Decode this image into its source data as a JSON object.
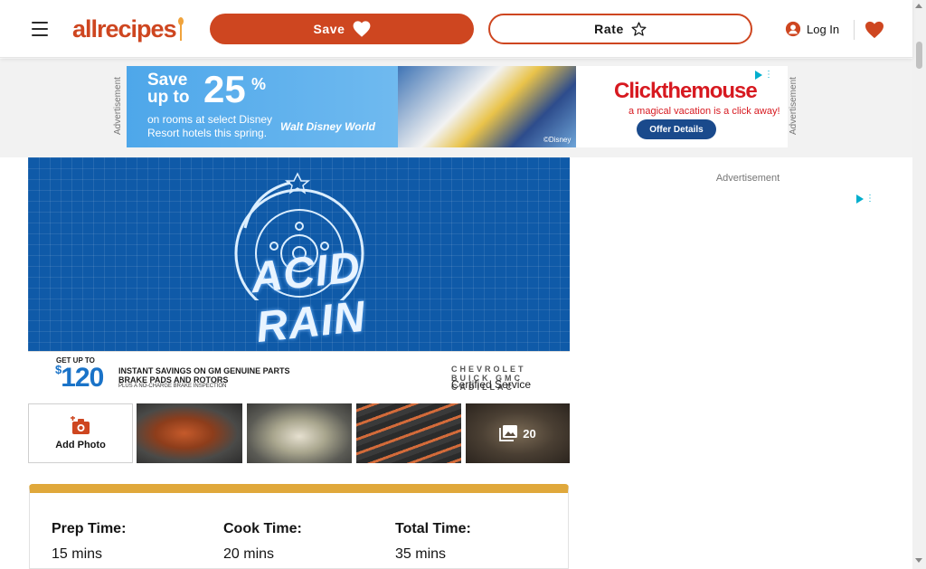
{
  "header": {
    "logo_text": "allrecipes",
    "save_label": "Save",
    "rate_label": "Rate",
    "login_label": "Log In"
  },
  "ads": {
    "top_label": "Advertisement",
    "banner": {
      "save_text_1": "Save",
      "save_text_2": "up to",
      "percent": "25",
      "percent_sign": "%",
      "desc_line_1": "on rooms at select Disney",
      "desc_line_2": "Resort hotels this spring.",
      "brand": "Walt Disney World",
      "credit": "©Disney",
      "right_brand": "Clickthemouse",
      "right_tagline": "a magical vacation is a click away!",
      "offer_button": "Offer Details"
    },
    "side_label": "Advertisement"
  },
  "hero": {
    "title": "ACID RAIN",
    "promo": {
      "get_up_to": "GET UP TO",
      "amount": "120",
      "currency": "$",
      "line1": "INSTANT SAVINGS ON GM GENUINE PARTS BRAKE PADS AND ROTORS",
      "line3": "PLUS A NO-CHARGE BRAKE INSPECTION",
      "brands": "CHEVROLET BUICK GMC CADILLAC",
      "certified": "Certified Service"
    }
  },
  "photos": {
    "add_label": "Add Photo",
    "count": "20"
  },
  "details": [
    {
      "label": "Prep Time:",
      "value": "15 mins"
    },
    {
      "label": "Cook Time:",
      "value": "20 mins"
    },
    {
      "label": "Total Time:",
      "value": "35 mins"
    }
  ],
  "colors": {
    "brand": "#ce4620",
    "accent_gold": "#e0a83b",
    "ad_blue": "#4ea7ea"
  }
}
